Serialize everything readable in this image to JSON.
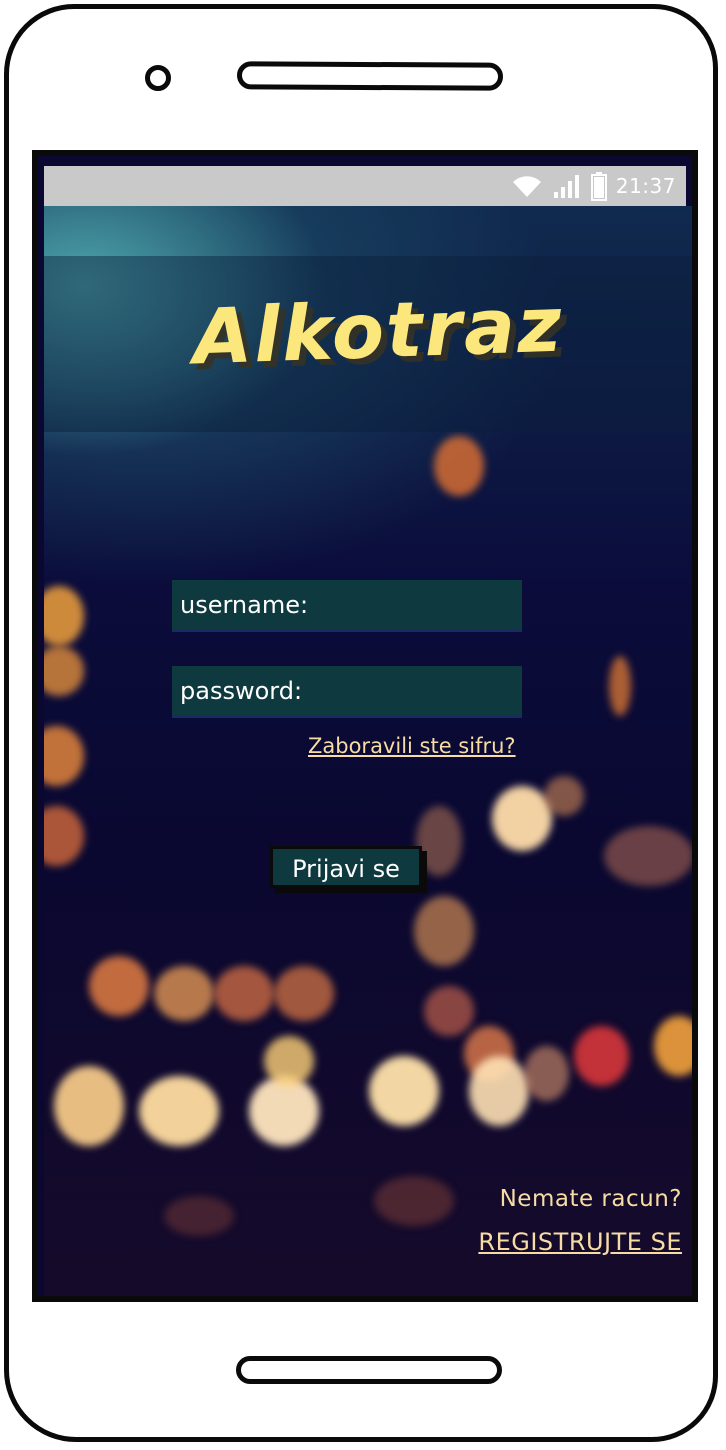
{
  "status_bar": {
    "time": "21:37",
    "icons": [
      "wifi-icon",
      "signal-icon",
      "battery-icon"
    ]
  },
  "app": {
    "logo_text": "Alkotraz"
  },
  "login_form": {
    "username_label": "username:",
    "password_label": "password:",
    "forgot_link": "Zaboravili ste sifru?",
    "submit_label": "Prijavi se"
  },
  "footer": {
    "no_account_text": "Nemate racun?",
    "register_link": "REGISTRUJTE SE"
  },
  "colors": {
    "field_bg": "#0e3a3f",
    "accent_text": "#f7dca4",
    "logo_yellow": "#fbe77b",
    "status_bar_bg": "#c9c9c9",
    "screen_bg": "#0a0830"
  }
}
